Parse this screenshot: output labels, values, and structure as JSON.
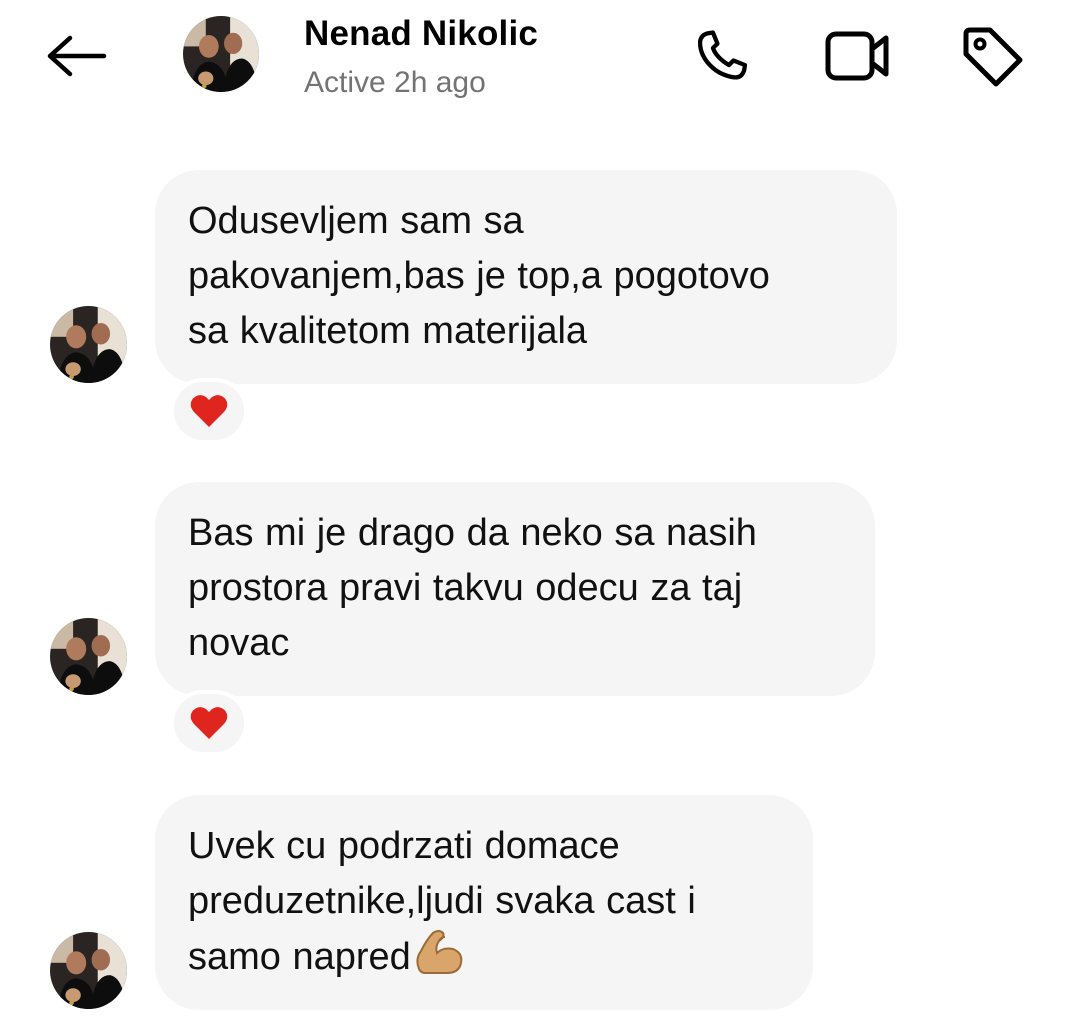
{
  "header": {
    "back_icon": "arrow-left-icon",
    "contact_name": "Nenad Nikolic",
    "status": "Active 2h ago",
    "call_icon": "phone-icon",
    "video_icon": "video-camera-icon",
    "tag_icon": "tag-icon"
  },
  "messages": [
    {
      "text": "Odusevljem sam sa\npakovanjem,bas je top,a pogotovo\nsa kvalitetom materijala",
      "reaction": "heart-icon"
    },
    {
      "text": "Bas mi je drago da neko sa nasih\nprostora pravi takvu odecu za taj\nnovac",
      "reaction": "heart-icon"
    },
    {
      "text": "Uvek cu podrzati domace\npreduzetnike,ljudi svaka cast i\nsamo napred",
      "emoji": "flexed-biceps-icon"
    }
  ],
  "colors": {
    "bubble_bg": "#f5f5f5",
    "heart": "#e0241e",
    "status_text": "#737373"
  }
}
